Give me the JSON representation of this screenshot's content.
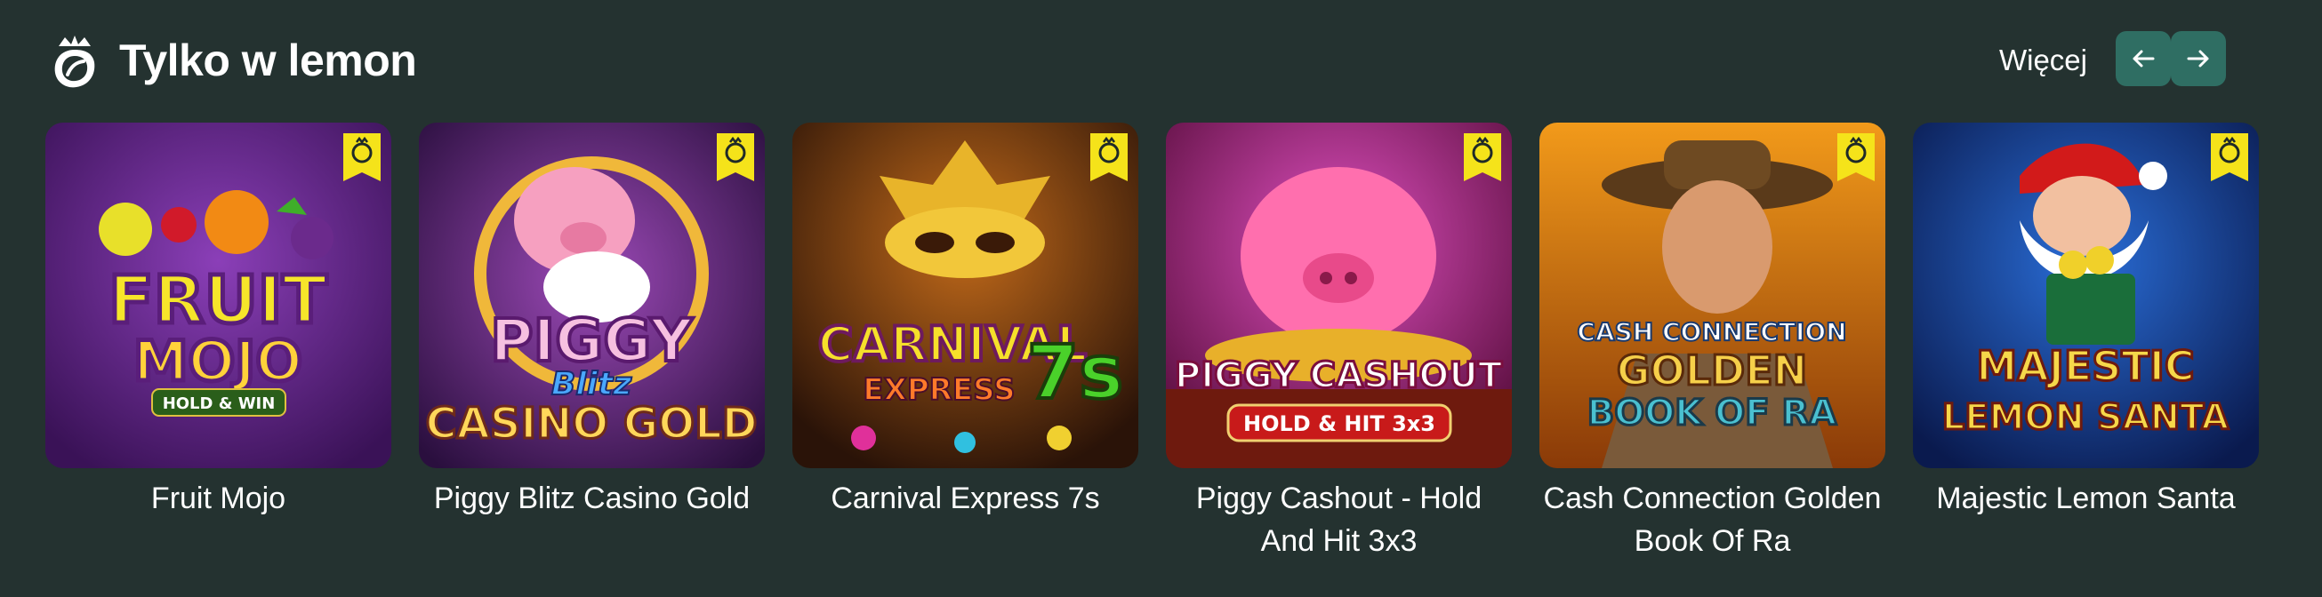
{
  "section": {
    "title": "Tylko w lemon",
    "more_label": "Więcej",
    "prev_icon": "arrow-left-icon",
    "next_icon": "arrow-right-icon"
  },
  "colors": {
    "background": "#243230",
    "nav_button": "#2f6e63",
    "badge": "#f5e31a"
  },
  "games": [
    {
      "name": "Fruit Mojo",
      "logo_lines": [
        "FRUIT",
        "MOJO",
        "HOLD & WIN"
      ]
    },
    {
      "name": "Piggy Blitz Casino Gold",
      "logo_lines": [
        "PIGGY",
        "Blitz",
        "CASINO GOLD"
      ]
    },
    {
      "name": "Carnival Express 7s",
      "logo_lines": [
        "CARNIVAL",
        "EXPRESS",
        "7s"
      ]
    },
    {
      "name": "Piggy Cashout - Hold And Hit 3x3",
      "logo_lines": [
        "PIGGY CASHOUT",
        "HOLD & HIT 3x3"
      ]
    },
    {
      "name": "Cash Connection Golden Book Of Ra",
      "logo_lines": [
        "CASH CONNECTION",
        "GOLDEN",
        "BOOK OF RA"
      ]
    },
    {
      "name": "Majestic Lemon Santa",
      "logo_lines": [
        "MAJESTIC",
        "LEMON SANTA"
      ]
    }
  ]
}
